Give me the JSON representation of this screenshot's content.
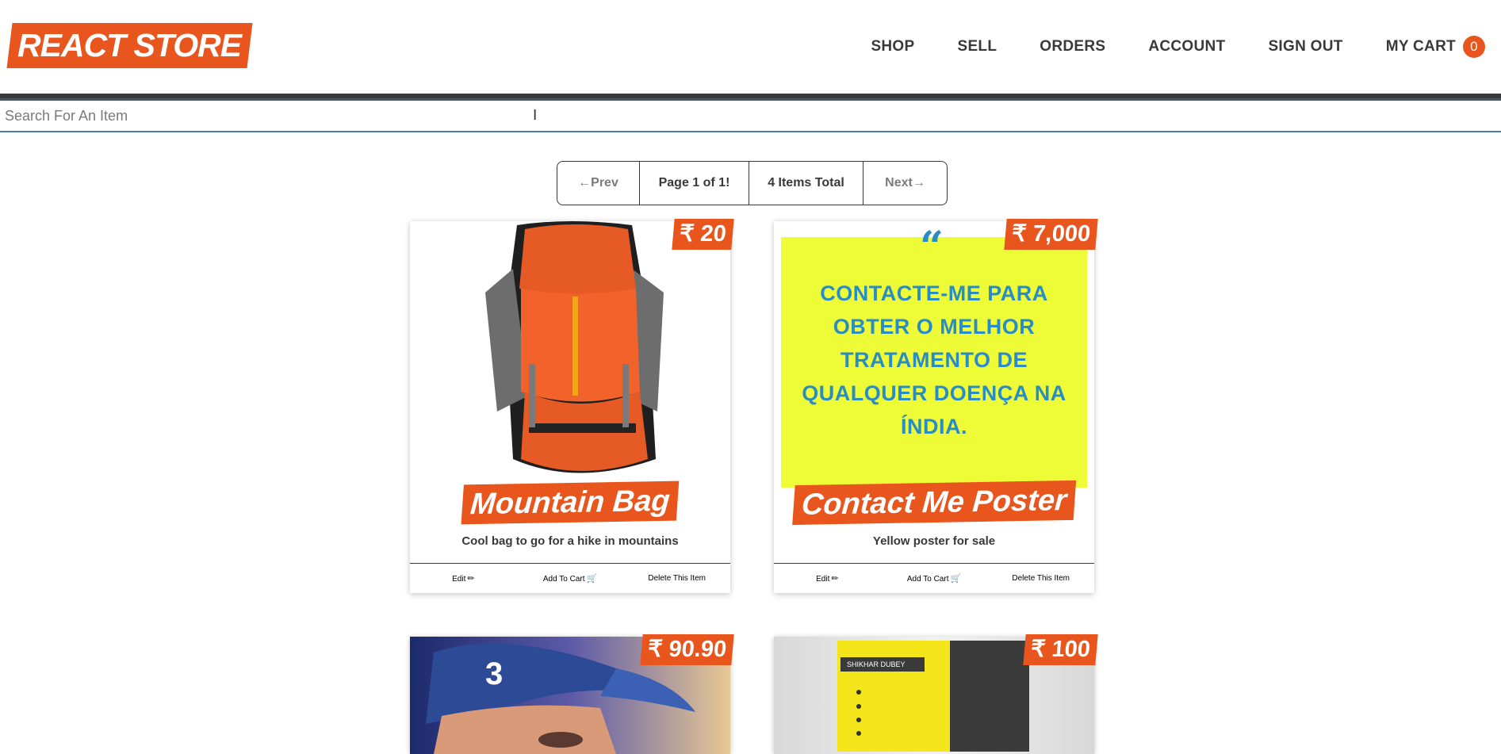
{
  "header": {
    "logo": "REACT STORE",
    "nav": [
      {
        "label": "SHOP"
      },
      {
        "label": "SELL"
      },
      {
        "label": "ORDERS"
      },
      {
        "label": "ACCOUNT"
      },
      {
        "label": "SIGN OUT"
      }
    ],
    "cart_label": "MY CART",
    "cart_count": "0"
  },
  "search": {
    "placeholder": "Search For An Item",
    "value": ""
  },
  "pagination": {
    "prev": "←Prev",
    "page": "Page 1 of 1!",
    "total": "4 Items Total",
    "next": "Next→"
  },
  "products": [
    {
      "title": "Mountain Bag",
      "price": "₹ 20",
      "description": "Cool bag to go for a hike in mountains",
      "edit": "Edit",
      "add_to_cart": "Add To Cart",
      "delete": "Delete This Item"
    },
    {
      "title": "Contact Me Poster",
      "price": "₹ 7,000",
      "description": "Yellow poster for sale",
      "edit": "Edit",
      "add_to_cart": "Add To Cart",
      "delete": "Delete This Item",
      "poster_text": "CONTACTE-ME PARA OBTER O MELHOR TRATAMENTO DE QUALQUER DOENÇA NA ÍNDIA."
    },
    {
      "price": "₹ 90.90"
    },
    {
      "price": "₹ 100",
      "card_name": "SHIKHAR DUBEY"
    }
  ],
  "colors": {
    "accent": "#e8561e",
    "text": "#393939",
    "poster_yellow": "#eefc38",
    "poster_blue": "#2a8cc4"
  },
  "icons": [
    "pencil-icon",
    "cart-icon",
    "text-cursor-icon",
    "quote-icon"
  ]
}
